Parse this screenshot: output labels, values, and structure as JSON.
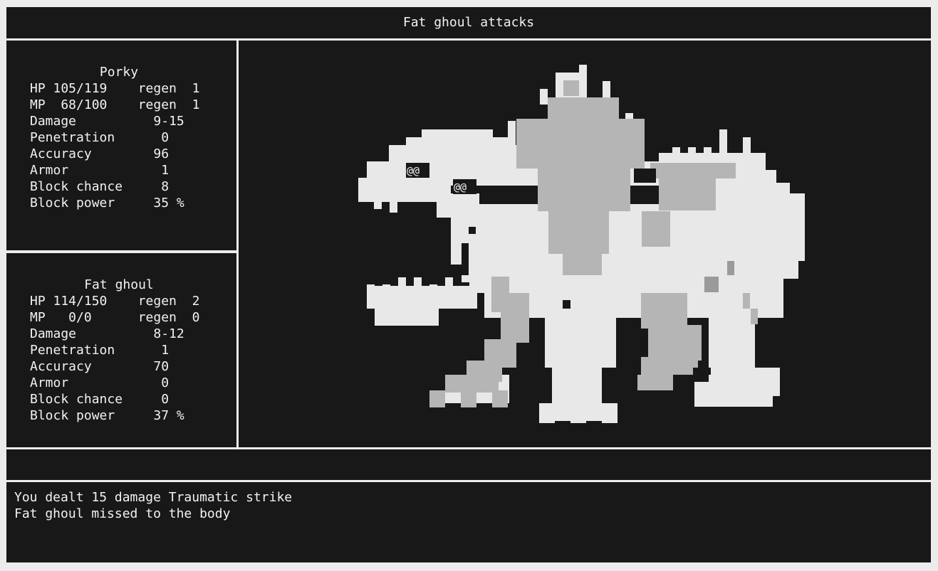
{
  "header": {
    "title": "Fat ghoul attacks"
  },
  "player": {
    "name": "Porky",
    "rows": [
      "HP 105/119    regen  1",
      "MP  68/100    regen  1",
      "Damage          9-15",
      "Penetration      0",
      "Accuracy        96",
      "Armor            1",
      "Block chance     8",
      "Block power     35 %"
    ]
  },
  "enemy": {
    "name": "Fat ghoul",
    "rows": [
      "HP 114/150    regen  2",
      "MP   0/0      regen  0",
      "Damage          8-12",
      "Penetration      1",
      "Accuracy        70",
      "Armor            0",
      "Block chance     0",
      "Block power     37 %"
    ]
  },
  "sprite": {
    "eye_left": "@@",
    "eye_right": "@@",
    "colors": {
      "light": "#e8e8e8",
      "mid": "#b5b5b5",
      "dark": "#9a9a9a",
      "background": "#181818"
    }
  },
  "log": {
    "lines": [
      "You dealt 15 damage Traumatic strike",
      "Fat ghoul missed to the body"
    ]
  }
}
